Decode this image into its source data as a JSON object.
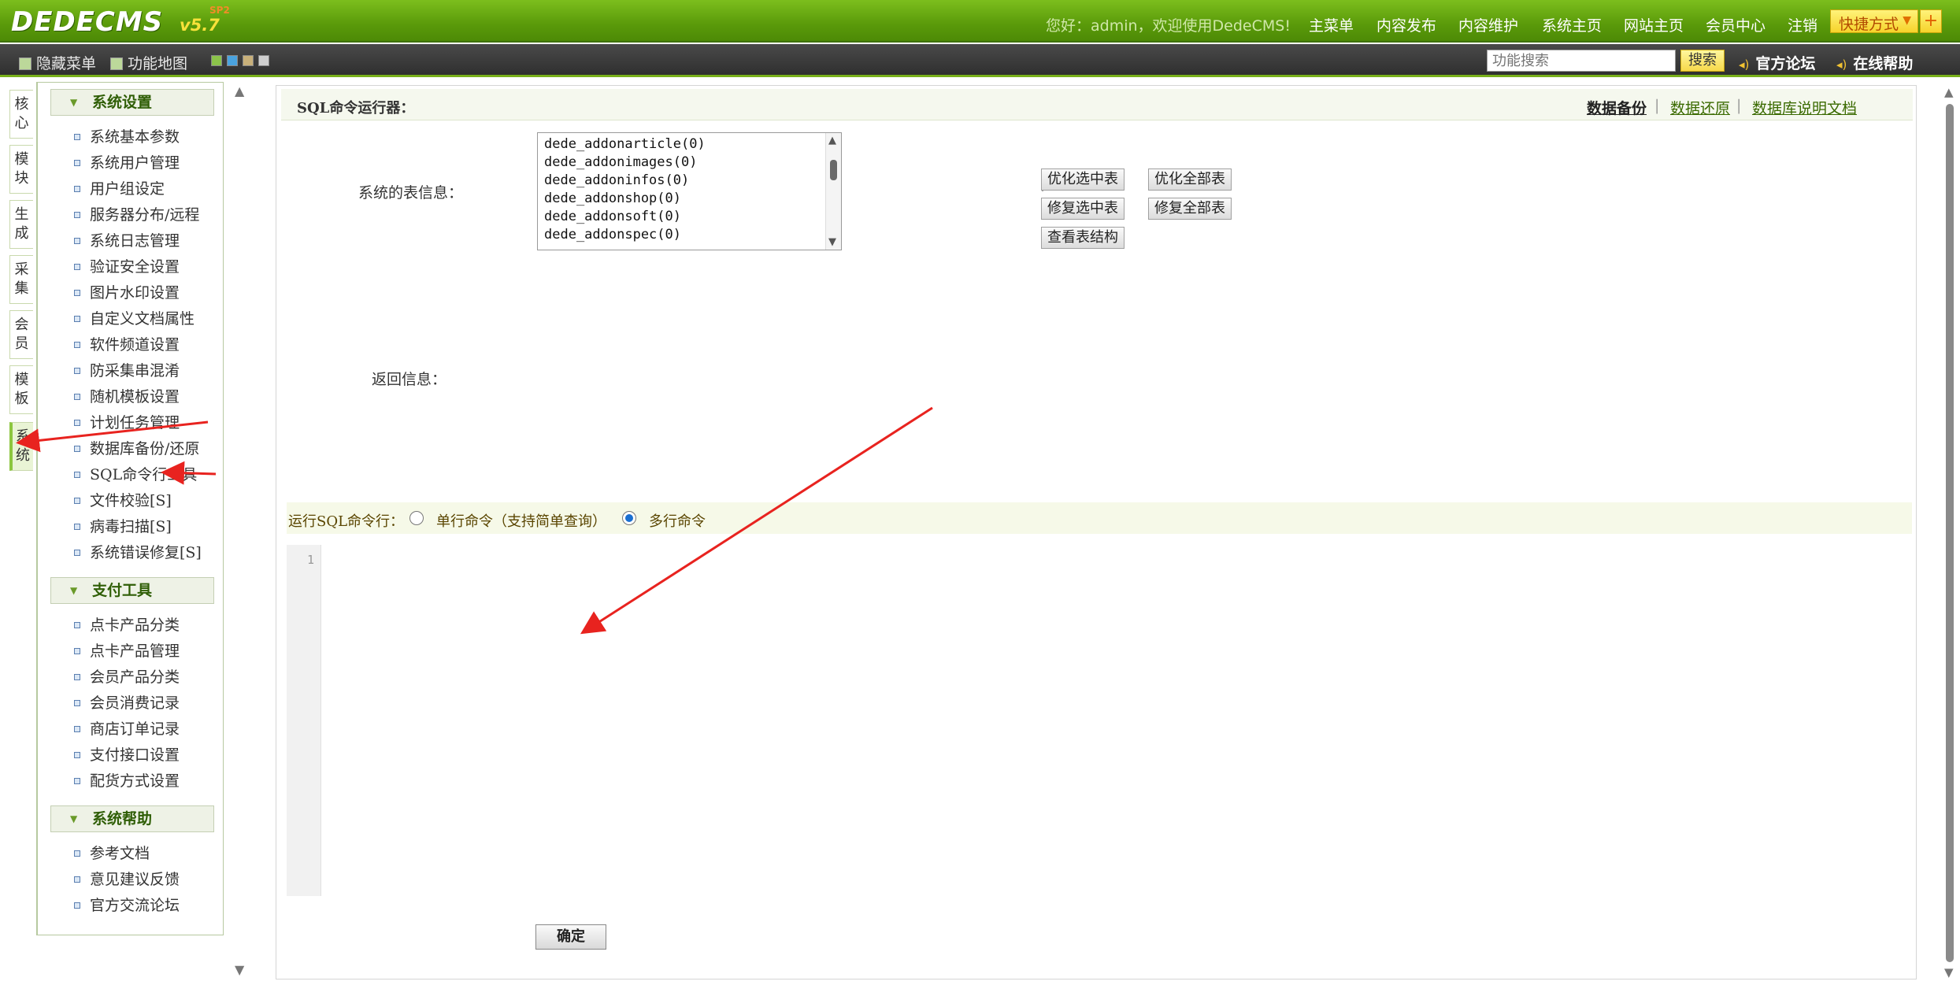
{
  "header": {
    "logo_text": "DEDECMS",
    "version": "v5.7",
    "version_tag": "SP2",
    "greeting": "您好：admin，欢迎使用DedeCMS!",
    "nav": [
      "主菜单",
      "内容发布",
      "内容维护",
      "系统主页",
      "网站主页",
      "会员中心",
      "注销"
    ],
    "quick_label": "快捷方式",
    "quick_plus": "+"
  },
  "toolbar": {
    "hide_menu": "隐藏菜单",
    "func_map": "功能地图",
    "search_placeholder": "功能搜索",
    "search_button": "搜索",
    "forum": "官方论坛",
    "help": "在线帮助"
  },
  "vtabs": [
    "核心",
    "模块",
    "生成",
    "采集",
    "会员",
    "模板",
    "系统"
  ],
  "menu": {
    "sections": [
      {
        "title": "系统设置",
        "items": [
          "系统基本参数",
          "系统用户管理",
          "用户组设定",
          "服务器分布/远程",
          "系统日志管理",
          "验证安全设置",
          "图片水印设置",
          "自定义文档属性",
          "软件频道设置",
          "防采集串混淆",
          "随机模板设置",
          "计划任务管理",
          "数据库备份/还原",
          "SQL命令行工具",
          "文件校验[S]",
          "病毒扫描[S]",
          "系统错误修复[S]"
        ]
      },
      {
        "title": "支付工具",
        "items": [
          "点卡产品分类",
          "点卡产品管理",
          "会员产品分类",
          "会员消费记录",
          "商店订单记录",
          "支付接口设置",
          "配货方式设置"
        ]
      },
      {
        "title": "系统帮助",
        "items": [
          "参考文档",
          "意见建议反馈",
          "官方交流论坛"
        ]
      }
    ]
  },
  "main": {
    "title": "SQL命令运行器：",
    "links": [
      "数据备份",
      "数据还原",
      "数据库说明文档"
    ],
    "table_info_label": "系统的表信息：",
    "tables": [
      "dede_addonarticle(0)",
      "dede_addonimages(0)",
      "dede_addoninfos(0)",
      "dede_addonshop(0)",
      "dede_addonsoft(0)",
      "dede_addonspec(0)"
    ],
    "buttons": {
      "optimize_selected": "优化选中表",
      "optimize_all": "优化全部表",
      "repair_selected": "修复选中表",
      "repair_all": "修复全部表",
      "view_structure": "查看表结构"
    },
    "return_label": "返回信息：",
    "run_label": "运行SQL命令行：",
    "radio_single": "单行命令（支持简单查询）",
    "radio_multi": "多行命令",
    "line_number": "1",
    "ok_button": "确定"
  },
  "colors": {
    "header_green": "#5a9a0a",
    "accent_green": "#78b01a",
    "annotation_arrow": "#e8231f"
  }
}
